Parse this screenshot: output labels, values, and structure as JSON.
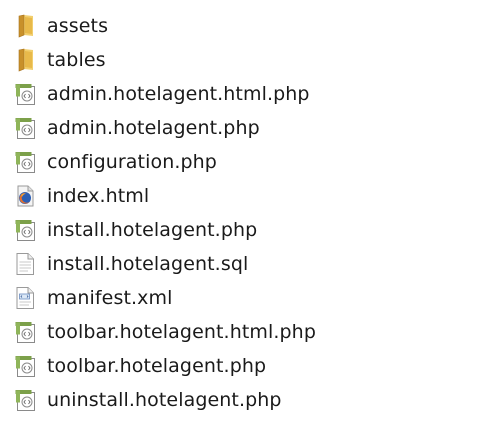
{
  "files": [
    {
      "name": "assets",
      "icon": "folder-icon"
    },
    {
      "name": "tables",
      "icon": "folder-icon"
    },
    {
      "name": "admin.hotelagent.html.php",
      "icon": "php-file-icon"
    },
    {
      "name": "admin.hotelagent.php",
      "icon": "php-file-icon"
    },
    {
      "name": "configuration.php",
      "icon": "php-file-icon"
    },
    {
      "name": "index.html",
      "icon": "firefox-html-file-icon"
    },
    {
      "name": "install.hotelagent.php",
      "icon": "php-file-icon"
    },
    {
      "name": "install.hotelagent.sql",
      "icon": "text-file-icon"
    },
    {
      "name": "manifest.xml",
      "icon": "xml-file-icon"
    },
    {
      "name": "toolbar.hotelagent.html.php",
      "icon": "php-file-icon"
    },
    {
      "name": "toolbar.hotelagent.php",
      "icon": "php-file-icon"
    },
    {
      "name": "uninstall.hotelagent.php",
      "icon": "php-file-icon"
    }
  ],
  "colors": {
    "folder": "#e8b94a",
    "php_accent": "#7ca04a",
    "background": "#ffffff",
    "text": "#1a1a1a"
  }
}
